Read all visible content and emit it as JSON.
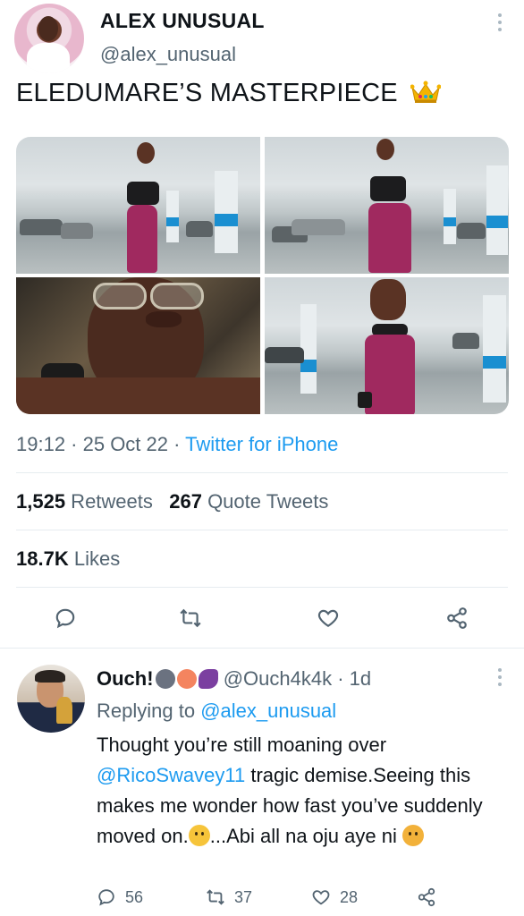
{
  "tweet": {
    "display_name": "ALEX UNUSUAL",
    "handle": "@alex_unusual",
    "text": "ELEDUMARE’S MASTERPIECE",
    "timestamp": "19:12 · 25 Oct 22 · ",
    "client": "Twitter for iPhone",
    "retweets_count": "1,525",
    "retweets_label": " Retweets",
    "quotes_count": "267",
    "quotes_label": " Quote Tweets",
    "likes_count": "18.7K",
    "likes_label": " Likes"
  },
  "reply": {
    "display_name": "Ouch!",
    "handle": "@Ouch4k4k",
    "time": " · 1d",
    "replying_prefix": "Replying to ",
    "replying_to": "@alex_unusual",
    "body_part1": "Thought you’re still moaning over ",
    "body_mention": "@RicoSwavey11",
    "body_part2": " tragic demise.Seeing this makes me wonder how fast you’ve suddenly moved on.",
    "body_part3": "...Abi all na oju aye ni ",
    "replies": "56",
    "retweets": "37",
    "likes": "28"
  },
  "icons": {
    "reply": "reply-icon",
    "retweet": "retweet-icon",
    "like": "heart-icon",
    "share": "share-icon",
    "more": "more-icon",
    "crown": "crown-emoji"
  },
  "colors": {
    "link": "#1d9bf0",
    "secondary_text": "#536471",
    "primary_text": "#0f1419"
  }
}
